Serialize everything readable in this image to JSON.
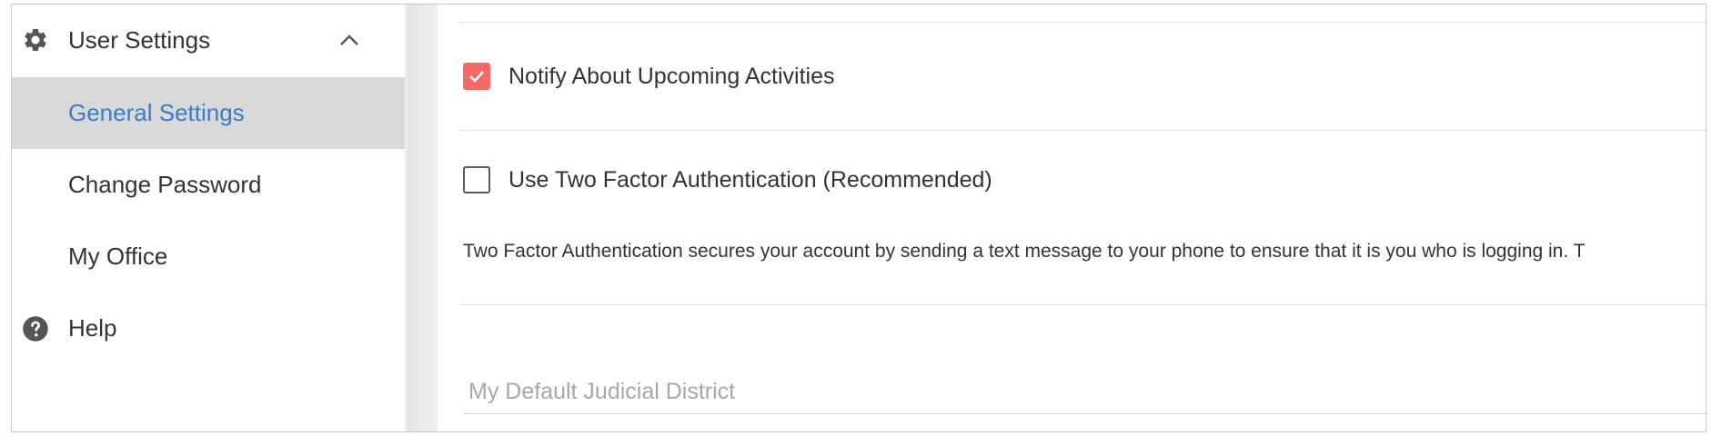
{
  "sidebar": {
    "group": {
      "label": "User Settings",
      "icon": "gear-icon",
      "expanded": true
    },
    "items": [
      {
        "label": "General Settings",
        "active": true
      },
      {
        "label": "Change Password",
        "active": false
      },
      {
        "label": "My Office",
        "active": false
      }
    ],
    "help": {
      "label": "Help",
      "icon": "help-circle-icon"
    }
  },
  "main": {
    "notify_checkbox": {
      "label": "Notify About Upcoming Activities",
      "checked": true
    },
    "two_factor_checkbox": {
      "label": "Use Two Factor Authentication (Recommended)",
      "checked": false
    },
    "two_factor_description": "Two Factor Authentication secures your account by sending a text message to your phone to ensure that it is you who is logging in. T",
    "judicial_district_field": {
      "placeholder": "My Default Judicial District",
      "value": ""
    }
  },
  "colors": {
    "accent_check": "#f26a6a",
    "active_text": "#3b7cc4",
    "active_bg": "#d9d9d9"
  }
}
